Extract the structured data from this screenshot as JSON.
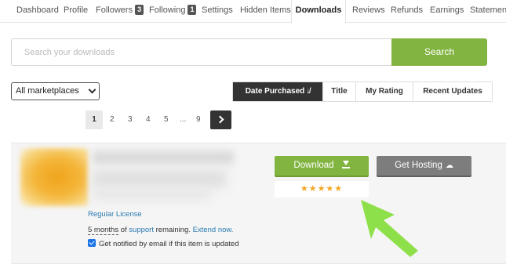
{
  "tabs": [
    {
      "label": "Dashboard"
    },
    {
      "label": "Profile"
    },
    {
      "label": "Followers",
      "count": "3"
    },
    {
      "label": "Following",
      "count": "1"
    },
    {
      "label": "Settings"
    },
    {
      "label": "Hidden Items"
    },
    {
      "label": "Downloads",
      "active": true
    },
    {
      "label": "Reviews"
    },
    {
      "label": "Refunds"
    },
    {
      "label": "Earnings"
    },
    {
      "label": "Statements"
    }
  ],
  "search": {
    "placeholder": "Search your downloads",
    "value": "",
    "button_label": "Search"
  },
  "marketplace_select": {
    "selected": "All marketplaces"
  },
  "sort": {
    "options": [
      "Date Purchased",
      "Title",
      "My Rating",
      "Recent Updates"
    ],
    "active": "Date Purchased",
    "active_icon": "sort-icon"
  },
  "pagination": {
    "pages": [
      "1",
      "2",
      "3",
      "4",
      "5",
      "...",
      "9"
    ],
    "current": "1",
    "next_icon": "chevron-right-icon"
  },
  "item": {
    "license": "Regular License",
    "support": {
      "months": "5 months",
      "of": "of",
      "support_link": "support",
      "remaining": "remaining.",
      "extend_link": "Extend now."
    },
    "notify": {
      "checked": true,
      "label": "Get notified by email if this item is updated"
    },
    "download_label": "Download",
    "hosting_label": "Get Hosting",
    "rating_stars": 5,
    "rating_text": "★★★★★"
  },
  "colors": {
    "accent_green": "#82b440",
    "dark": "#333333",
    "link_blue": "#2a7ab0",
    "star": "#f5a623",
    "pointer_green": "#8ee04a"
  }
}
